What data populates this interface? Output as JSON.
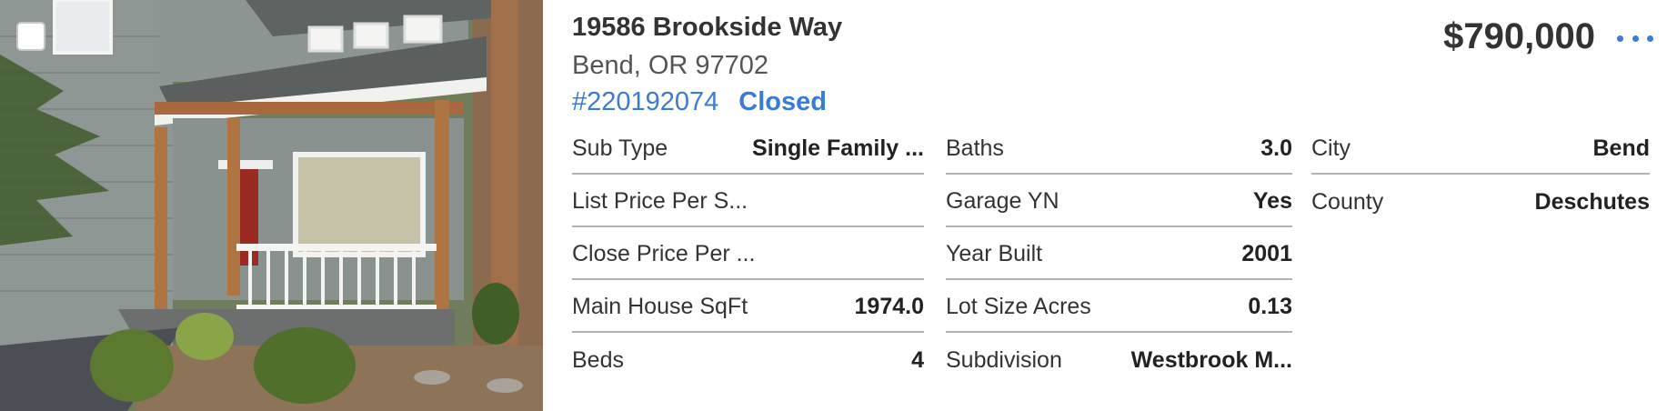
{
  "listing": {
    "address": "19586 Brookside Way",
    "city_state_zip": "Bend, OR 97702",
    "mls_number": "#220192074",
    "status": "Closed",
    "price": "$790,000"
  },
  "columns": [
    [
      {
        "label": "Sub Type",
        "value": "Single Family ..."
      },
      {
        "label": "List Price Per S...",
        "value": ""
      },
      {
        "label": "Close Price Per ...",
        "value": ""
      },
      {
        "label": "Main House SqFt",
        "value": "1974.0"
      },
      {
        "label": "Beds",
        "value": "4"
      }
    ],
    [
      {
        "label": "Baths",
        "value": "3.0"
      },
      {
        "label": "Garage YN",
        "value": "Yes"
      },
      {
        "label": "Year Built",
        "value": "2001"
      },
      {
        "label": "Lot Size Acres",
        "value": "0.13"
      },
      {
        "label": "Subdivision",
        "value": "Westbrook M..."
      }
    ],
    [
      {
        "label": "City",
        "value": "Bend"
      },
      {
        "label": "County",
        "value": "Deschutes"
      }
    ]
  ],
  "colors": {
    "accent": "#3a7bd5",
    "text": "#333333",
    "divider": "#b3b3b3"
  },
  "icons": {
    "more": "more-horizontal-icon",
    "select": "checkbox-icon"
  }
}
